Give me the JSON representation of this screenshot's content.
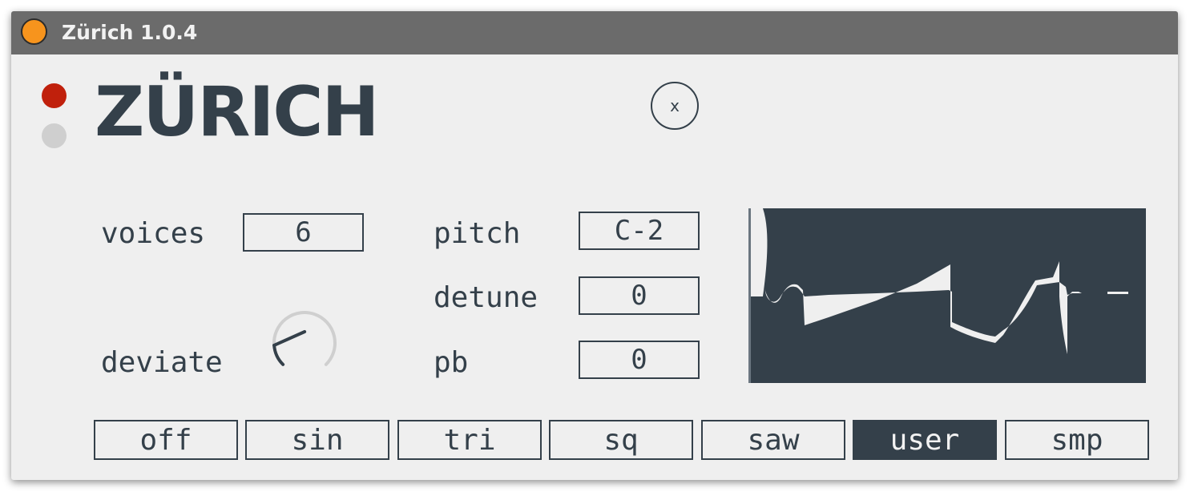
{
  "window": {
    "title": "Zürich 1.0.4",
    "title_icon": "orange-circle-icon",
    "accent": "#f7941d"
  },
  "header": {
    "brand": "ZÜRICH",
    "close_label": "x",
    "led_active_color": "#c0200c",
    "led_inactive_color": "#cfcfcf"
  },
  "controls": {
    "voices_label": "voices",
    "voices_value": "6",
    "deviate_label": "deviate",
    "deviate_level": 0.15,
    "pitch_label": "pitch",
    "pitch_value": "C-2",
    "detune_label": "detune",
    "detune_value": "0",
    "pb_label": "pb",
    "pb_value": "0"
  },
  "waveforms": {
    "options": [
      "off",
      "sin",
      "tri",
      "sq",
      "saw",
      "user",
      "smp"
    ],
    "selected": "user"
  },
  "colors": {
    "ink": "#34404a",
    "panel": "#efefef"
  }
}
